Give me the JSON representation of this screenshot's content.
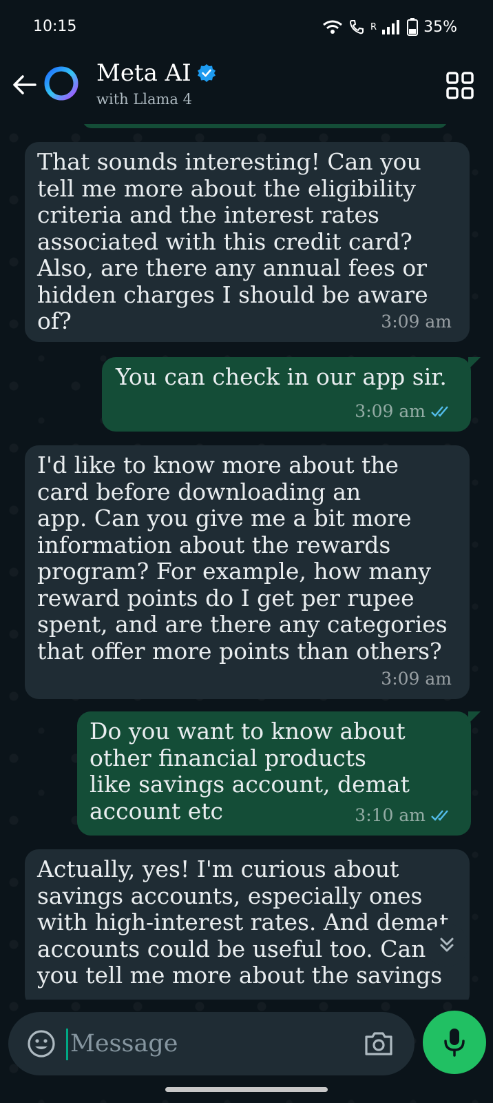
{
  "status_bar": {
    "time": "10:15",
    "carrier_indicator": "R",
    "battery": "35%"
  },
  "header": {
    "title": "Meta AI",
    "subtitle": "with Llama 4",
    "verified": true
  },
  "messages": [
    {
      "direction": "incoming",
      "text": "That sounds interesting! Can you\ntell me more about the eligibility\ncriteria and the interest rates\nassociated with this credit card?\nAlso, are there any annual fees or\nhidden charges I should be aware\nof?",
      "time": "3:09 am"
    },
    {
      "direction": "outgoing",
      "text": "You can check in our app sir.",
      "time": "3:09 am",
      "read": true
    },
    {
      "direction": "incoming",
      "text": "I'd like to know more about the\ncard before downloading an\napp. Can you give me a bit more\ninformation about the rewards\nprogram? For example, how many\nreward points do I get per rupee\nspent, and are there any categories\nthat offer more points than others?",
      "time": "3:09 am"
    },
    {
      "direction": "outgoing",
      "text": "Do you want to know about\nother financial products\nlike savings account, demat\naccount etc",
      "time": "3:10 am",
      "read": true
    },
    {
      "direction": "incoming",
      "text": "Actually, yes! I'm curious about\nsavings accounts, especially ones\nwith high-interest rates. And demat\naccounts could be useful too. Can\nyou tell me more about the savings"
    }
  ],
  "composer": {
    "placeholder": "Message"
  },
  "colors": {
    "background": "#0b141a",
    "incoming_bubble": "#1f2c34",
    "outgoing_bubble": "#144d37",
    "accent_green": "#21c063",
    "read_tick": "#53bdeb"
  },
  "icons": {
    "back": "back-arrow-icon",
    "avatar": "meta-ai-ring-icon",
    "verified": "verified-badge-icon",
    "menu": "grid-menu-icon",
    "scroll": "double-chevron-down-icon",
    "emoji": "emoji-icon",
    "camera": "camera-icon",
    "mic": "microphone-icon"
  }
}
